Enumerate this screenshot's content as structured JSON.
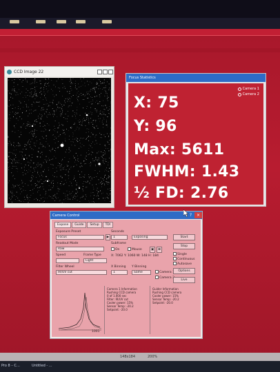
{
  "ccd_window": {
    "title": "CCD Image 22"
  },
  "focus_window": {
    "title": "Focus Statistics",
    "cameras": [
      "Camera 1",
      "Camera 2"
    ],
    "stats": [
      {
        "label": "X:",
        "value": "75"
      },
      {
        "label": "Y:",
        "value": "96"
      },
      {
        "label": "Max:",
        "value": "5611"
      },
      {
        "label": "FWHM:",
        "value": "1.43"
      },
      {
        "label": "½ FD:",
        "value": "2.76"
      }
    ]
  },
  "camera_control": {
    "title": "Camera Control",
    "tabs": [
      "Expose",
      "Guide",
      "Setup",
      "TDI"
    ],
    "exposure_preset_label": "Exposure Preset",
    "exposure_preset_value": "Focus",
    "seconds_label": "Seconds",
    "seconds_value": "1",
    "status_value": "Exposing",
    "readout_mode_label": "Readout Mode",
    "readout_mode_value": "Raw",
    "subframe_label": "Subframe",
    "on_label": "On",
    "mouse_label": "Mouse",
    "subframe_coords": "X: 7062 Y: 1060 W: 148 H: 184",
    "speed_label": "Speed",
    "frame_type_label": "Frame Type",
    "frame_type_value": "Light",
    "filter_wheel_label": "Filter Wheel",
    "filter_value": "IR/UV cut",
    "x_binning_label": "X Binning",
    "y_binning_label": "Y Binning",
    "x_binning_value": "1",
    "same_value": "Same",
    "start_label": "Start",
    "stop_label": "Stop",
    "single_label": "Single",
    "continuous_label": "Continuous",
    "autosave_label": "Autosave",
    "options_label": "Options",
    "camera1_label": "Camera 1",
    "camera2_label": "Camera 2",
    "live_label": "Live",
    "camera_info": [
      "Camera 1 Information",
      "Rushing CCD camera",
      "0 of 1.000 sec",
      "Filter: IR/UV cut",
      "Cooler power: 15%",
      "Sensor Temp: -20.2",
      "Setpoint: -20.0"
    ],
    "guider_info": [
      "Guider Information",
      "Rushing CCD camera",
      "",
      "",
      "Cooler power: 15%",
      "Sensor Temp: -20.2",
      "Setpoint: -20.0"
    ],
    "peak_label": "1001"
  },
  "statusbar": {
    "size": "148x184",
    "zoom": "200%"
  },
  "taskbar": {
    "items": [
      "Pro 8 – C…",
      "Untitled - ..."
    ]
  }
}
